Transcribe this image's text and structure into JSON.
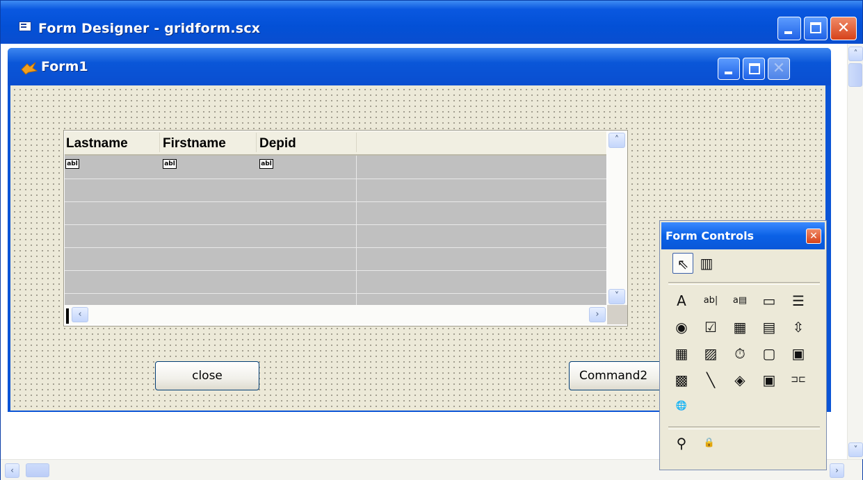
{
  "outer_window": {
    "title": "Form Designer - gridform.scx",
    "icon": "form-designer-icon"
  },
  "form_window": {
    "title": "Form1",
    "icon": "foxpro-icon"
  },
  "grid": {
    "columns": [
      "Lastname",
      "Firstname",
      "Depid"
    ],
    "cell_control_label": "abl",
    "row_count": 6
  },
  "buttons": {
    "close_label": "close",
    "command2_label": "Command2"
  },
  "form_controls": {
    "title": "Form Controls",
    "top_tools": [
      {
        "name": "pointer-icon",
        "glyph": "⇖"
      },
      {
        "name": "view-classes-icon",
        "glyph": "▥"
      }
    ],
    "tools": [
      {
        "name": "label-icon",
        "glyph": "A"
      },
      {
        "name": "textbox-icon",
        "glyph": "ab|"
      },
      {
        "name": "editbox-icon",
        "glyph": "a▤"
      },
      {
        "name": "command-button-icon",
        "glyph": "▭"
      },
      {
        "name": "command-group-icon",
        "glyph": "☰"
      },
      {
        "name": "option-group-icon",
        "glyph": "◉"
      },
      {
        "name": "checkbox-icon",
        "glyph": "☑"
      },
      {
        "name": "combobox-icon",
        "glyph": "▦"
      },
      {
        "name": "listbox-icon",
        "glyph": "▤"
      },
      {
        "name": "spinner-icon",
        "glyph": "⇳"
      },
      {
        "name": "grid-icon",
        "glyph": "▦"
      },
      {
        "name": "image-icon",
        "glyph": "▨"
      },
      {
        "name": "timer-icon",
        "glyph": "⏱"
      },
      {
        "name": "pageframe-icon",
        "glyph": "▢"
      },
      {
        "name": "ole-container-icon",
        "glyph": "▣"
      },
      {
        "name": "ole-bound-icon",
        "glyph": "▩"
      },
      {
        "name": "line-icon",
        "glyph": "╲"
      },
      {
        "name": "shape-icon",
        "glyph": "◈"
      },
      {
        "name": "container-icon",
        "glyph": "▣"
      },
      {
        "name": "separator-icon",
        "glyph": "⊐⊏"
      },
      {
        "name": "hyperlink-icon",
        "glyph": "🌐"
      }
    ],
    "bottom_tools": [
      {
        "name": "builder-lock-icon",
        "glyph": "⚲"
      },
      {
        "name": "lock-icon",
        "glyph": "🔒"
      }
    ]
  },
  "colors": {
    "xp_blue": "#0a54d6",
    "form_background": "#ece9d8",
    "grid_cell": "#c0c0c0"
  }
}
